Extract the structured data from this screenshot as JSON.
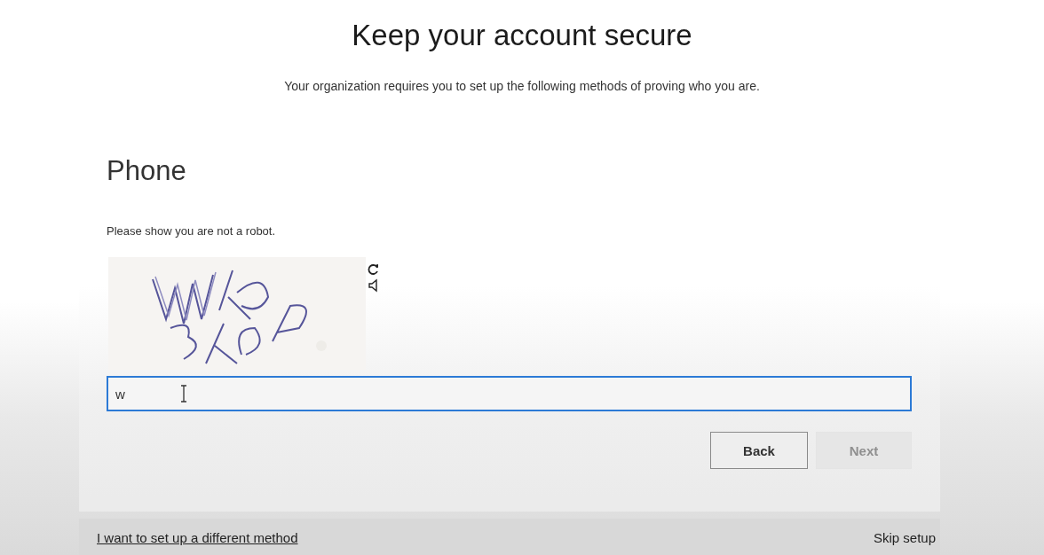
{
  "title": "Keep your account secure",
  "subtitle": "Your organization requires you to set up the following methods of proving who you are.",
  "card": {
    "heading": "Phone",
    "prompt": "Please show you are not a robot.",
    "answer": {
      "value": "w",
      "focused": true
    },
    "buttons": [
      {
        "label": "Back",
        "disabled": false
      },
      {
        "label": "Next",
        "disabled": true
      }
    ]
  },
  "footer": {
    "link": "I want to set up a different method",
    "skip": "Skip setup"
  }
}
